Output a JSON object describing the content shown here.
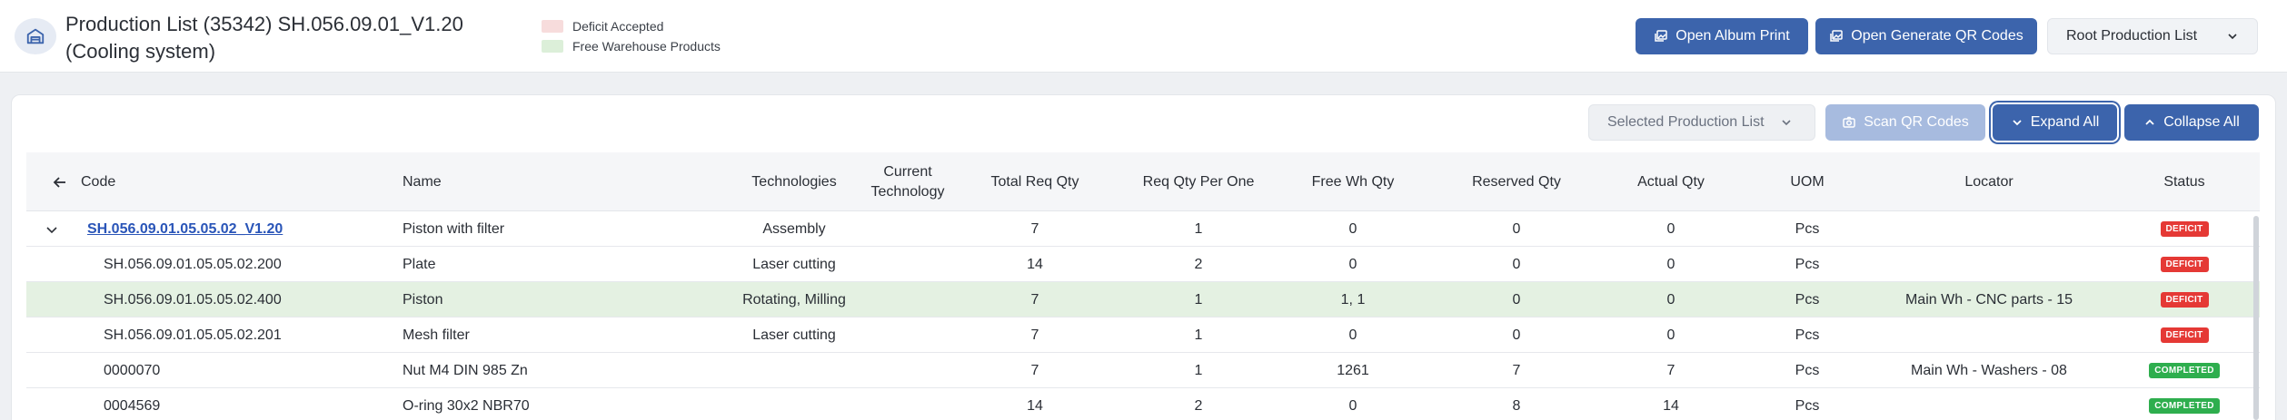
{
  "header": {
    "title": "Production List (35342) SH.056.09.01_V1.20 (Cooling system)",
    "legend": [
      {
        "label": "Deficit Accepted",
        "color": "#f7dcdc"
      },
      {
        "label": "Free Warehouse Products",
        "color": "#dcefd9"
      }
    ],
    "open_album_print": "Open Album Print",
    "open_generate_qr": "Open Generate QR Codes",
    "root_select": "Root Production List"
  },
  "toolbar": {
    "selected_production_list": "Selected Production List",
    "scan_qr": "Scan QR Codes",
    "expand_all": "Expand All",
    "collapse_all": "Collapse All"
  },
  "table": {
    "columns": {
      "code": "Code",
      "name": "Name",
      "technologies": "Technologies",
      "current_technology": "Current Technology",
      "total_req_qty": "Total Req Qty",
      "req_qty_per_one": "Req Qty Per One",
      "free_wh_qty": "Free Wh Qty",
      "reserved_qty": "Reserved Qty",
      "actual_qty": "Actual Qty",
      "uom": "UOM",
      "locator": "Locator",
      "status": "Status"
    },
    "rows": [
      {
        "code": "SH.056.09.01.05.05.02_V1.20",
        "name": "Piston with filter",
        "tech": "Assembly",
        "current": "",
        "total": "7",
        "per_one": "1",
        "free": "0",
        "reserved": "0",
        "actual": "0",
        "uom": "Pcs",
        "locator": "",
        "status": "DEFICIT"
      },
      {
        "code": "SH.056.09.01.05.05.02.200",
        "name": "Plate",
        "tech": "Laser cutting",
        "current": "",
        "total": "14",
        "per_one": "2",
        "free": "0",
        "reserved": "0",
        "actual": "0",
        "uom": "Pcs",
        "locator": "",
        "status": "DEFICIT"
      },
      {
        "code": "SH.056.09.01.05.05.02.400",
        "name": "Piston",
        "tech": "Rotating, Milling",
        "current": "",
        "total": "7",
        "per_one": "1",
        "free": "1, 1",
        "reserved": "0",
        "actual": "0",
        "uom": "Pcs",
        "locator": "Main Wh - CNC parts - 15",
        "status": "DEFICIT"
      },
      {
        "code": "SH.056.09.01.05.05.02.201",
        "name": "Mesh filter",
        "tech": "Laser cutting",
        "current": "",
        "total": "7",
        "per_one": "1",
        "free": "0",
        "reserved": "0",
        "actual": "0",
        "uom": "Pcs",
        "locator": "",
        "status": "DEFICIT"
      },
      {
        "code": "0000070",
        "name": "Nut M4 DIN 985 Zn",
        "tech": "",
        "current": "",
        "total": "7",
        "per_one": "1",
        "free": "1261",
        "reserved": "7",
        "actual": "7",
        "uom": "Pcs",
        "locator": "Main Wh - Washers - 08",
        "status": "COMPLETED"
      },
      {
        "code": "0004569",
        "name": "O-ring 30x2 NBR70",
        "tech": "",
        "current": "",
        "total": "14",
        "per_one": "2",
        "free": "0",
        "reserved": "8",
        "actual": "14",
        "uom": "Pcs",
        "locator": "",
        "status": "COMPLETED"
      }
    ]
  },
  "colors": {
    "primary": "#3c64ac",
    "deficit": "#e53935",
    "completed": "#2eae4e",
    "free_row": "#e4f1e2"
  }
}
